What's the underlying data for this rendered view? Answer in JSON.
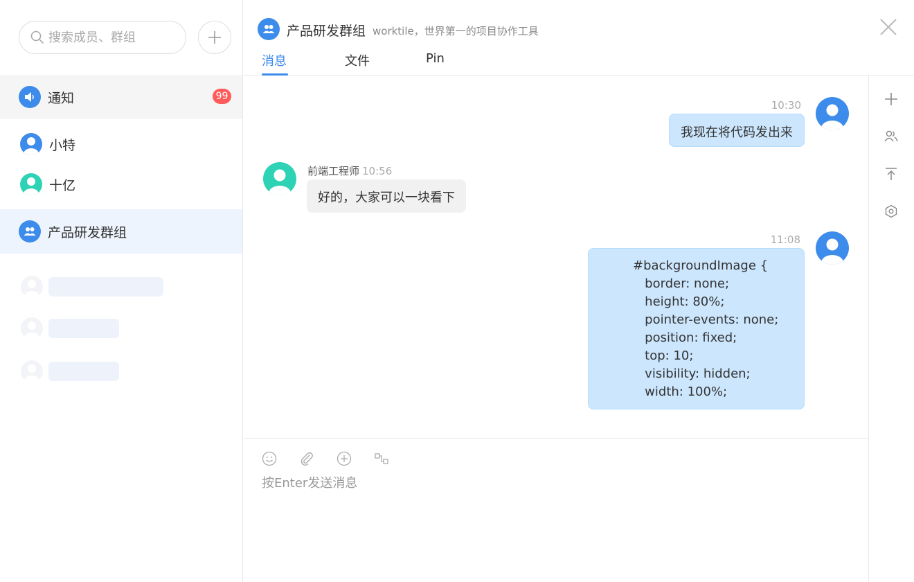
{
  "sidebar": {
    "search_placeholder": "搜索成员、群组",
    "notice": {
      "label": "通知",
      "badge": "99"
    },
    "contacts": [
      {
        "name": "小特",
        "color": "#3d8bea"
      },
      {
        "name": "十亿",
        "color": "#2ed3b5"
      }
    ],
    "group": {
      "name": "产品研发群组"
    }
  },
  "header": {
    "group_name": "产品研发群组",
    "group_desc": "worktile，世界第一的项目协作工具",
    "tabs": [
      "消息",
      "文件",
      "Pin"
    ],
    "active_tab": "消息"
  },
  "messages": [
    {
      "time": "10:30",
      "text": "我现在将代码发出来",
      "self": true
    },
    {
      "sender": "前端工程师",
      "time": "10:56",
      "text": "好的，大家可以一块看下",
      "self": false
    },
    {
      "time": "11:08",
      "self": true,
      "code": [
        "#backgroundImage {",
        "   border: none;",
        "   height: 80%;",
        "   pointer-events: none;",
        "   position: fixed;",
        "   top: 10;",
        "   visibility: hidden;",
        "   width: 100%;"
      ]
    }
  ],
  "composer": {
    "placeholder": "按Enter发送消息"
  },
  "colors": {
    "accent": "#3d8bea",
    "teal": "#2ed3b5",
    "badge": "#ff5b5b",
    "my_bubble": "#cce6fd",
    "other_bubble": "#f1f1f1"
  },
  "icons": [
    "search-icon",
    "plus-icon",
    "speaker-icon",
    "user-avatar-icon",
    "group-icon",
    "close-icon",
    "emoji-icon",
    "attachment-icon",
    "add-circle-icon",
    "snippet-icon",
    "members-icon",
    "pin-top-icon",
    "settings-icon"
  ]
}
